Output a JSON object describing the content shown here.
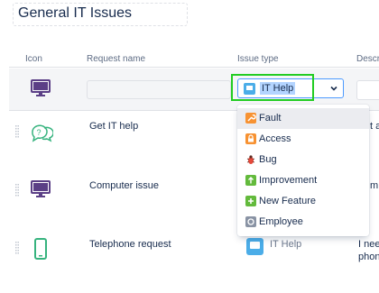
{
  "page": {
    "title": "General IT Issues"
  },
  "table": {
    "columns": {
      "icon": "Icon",
      "name": "Request name",
      "issue_type": "Issue type",
      "description": "Descri"
    },
    "edit_row": {
      "name_value": "",
      "issue_type_selected": "IT Help",
      "issue_type_icon": "monitor-icon"
    },
    "rows": [
      {
        "icon": "question-bubble-icon",
        "name": "Get IT help",
        "description": "t a"
      },
      {
        "icon": "monitor-icon",
        "name": "Computer issue",
        "description": "m"
      },
      {
        "icon": "phone-icon",
        "name": "Telephone request",
        "issue_type": "IT Help",
        "issue_type_icon": "monitor-icon",
        "description": "I nee",
        "description_line2": "phon"
      }
    ]
  },
  "dropdown": {
    "options": [
      {
        "label": "Fault",
        "icon": "wrench-icon",
        "color": "#f79232"
      },
      {
        "label": "Access",
        "icon": "lock-icon",
        "color": "#f79232"
      },
      {
        "label": "Bug",
        "icon": "bug-icon",
        "color": "#e5493a"
      },
      {
        "label": "Improvement",
        "icon": "arrow-up-icon",
        "color": "#63ba3c"
      },
      {
        "label": "New Feature",
        "icon": "plus-icon",
        "color": "#63ba3c"
      },
      {
        "label": "Employee",
        "icon": "person-icon",
        "color": "#8993a4"
      }
    ],
    "highlighted": "Fault"
  },
  "colors": {
    "select_blue": "#4bade8",
    "focus_border": "#4c9aff",
    "highlight_box": "#22cc22",
    "icon_purple": "#6554c0",
    "icon_green": "#36b37e"
  }
}
